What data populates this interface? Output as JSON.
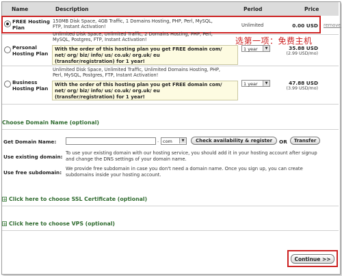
{
  "table": {
    "headers": {
      "name": "Name",
      "description": "Description",
      "period": "Period",
      "price": "Price"
    },
    "plans": [
      {
        "name_line1": "FREE Hosting",
        "name_line2": "Plan",
        "selected": true,
        "desc_lines": [
          "150MB Disk Space, 4GB Traffic, 1 Domains Hosting, PHP, Perl, MySQL,",
          "FTP, Instant Activation!"
        ],
        "period": "Unlimited",
        "price": "0.00 USD",
        "remove": "remove"
      },
      {
        "name_line1": "Personal",
        "name_line2": "Hosting Plan",
        "selected": false,
        "desc_lines": [
          "Unlimited Disk Space, Unlimited Traffic, 2 Domains Hosting, PHP, Perl,",
          "MySQL, Postgres, FTP, Instant Activation!"
        ],
        "promo_lines": [
          "With the order of this hosting plan you get FREE domain com/",
          "net/ org/ biz/ info/ us/ co.uk/ org.uk/ eu",
          "(transfer/registration) for 1 year!"
        ],
        "period": "1 year",
        "price": "35.88 USD",
        "per_month": "(2.99 USD/mo)"
      },
      {
        "name_line1": "Business",
        "name_line2": "Hosting Plan",
        "selected": false,
        "desc_lines": [
          "Unlimited Disk Space, Unlimited Traffic, Unlimited Domains Hosting, PHP,",
          "Perl, MySQL, Postgres, FTP, Instant Activation!"
        ],
        "promo_lines": [
          "With the order of this hosting plan you get FREE domain com/",
          "net/ org/ biz/ info/ us/ co.uk/ org.uk/ eu",
          "(transfer/registration) for 1 year!"
        ],
        "period": "1 year",
        "price": "47.88 USD",
        "per_month": "(3.99 USD/mo)"
      }
    ]
  },
  "annotation": "选第一项：免费主机",
  "domain_section": {
    "title": "Choose Domain Name (optional)",
    "get_domain_label": "Get Domain Name:",
    "domain_input_value": "",
    "dot": ".",
    "tld": "com",
    "check_button": "Check availability & register",
    "or_text": "OR",
    "transfer_button": "Transfer",
    "existing_label": "Use existing domain:",
    "existing_text": [
      "To use your existing domain with our hosting service, you should add it in your hosting account after signup",
      "and change the DNS settings of your domain name."
    ],
    "subdomain_label": "Use free subdomain:",
    "subdomain_text": [
      "We provide free subdomain in case you don't need a domain name. Once you sign up, you can create",
      "subdomains inside your hosting account."
    ]
  },
  "ssl_link": "Click here to choose SSL Certificate (optional)",
  "vps_link": "Click here to choose VPS (optional)",
  "continue_button": "Continue >>",
  "colors": {
    "highlight_red": "#cc2020",
    "section_green": "#2f6b2f",
    "promo_bg": "#fdfbe1",
    "header_bg": "#dcdcdc"
  }
}
